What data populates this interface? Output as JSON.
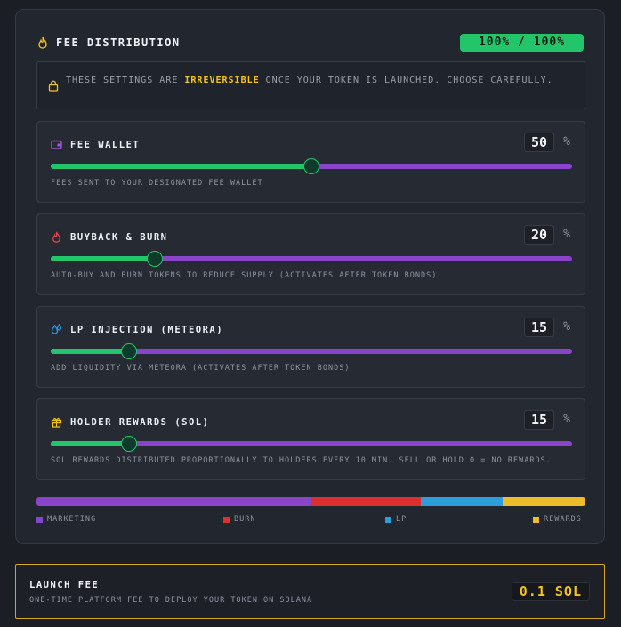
{
  "distribution": {
    "title": "FEE DISTRIBUTION",
    "badge": "100% / 100%",
    "warning": {
      "prefix": "THESE SETTINGS ARE ",
      "highlight": "IRREVERSIBLE",
      "suffix": " ONCE YOUR TOKEN IS LAUNCHED. CHOOSE CAREFULLY."
    },
    "percent_sign": "%",
    "sliders": [
      {
        "title": "FEE WALLET",
        "value": 50,
        "description": "FEES SENT TO YOUR DESIGNATED FEE WALLET",
        "icon": "wallet-icon",
        "icon_color": "#9b59d6"
      },
      {
        "title": "BUYBACK & BURN",
        "value": 20,
        "description": "AUTO-BUY AND BURN TOKENS TO REDUCE SUPPLY (ACTIVATES AFTER TOKEN BONDS)",
        "icon": "flame-icon",
        "icon_color": "#e04444"
      },
      {
        "title": "LP INJECTION (METEORA)",
        "value": 15,
        "description": "ADD LIQUIDITY VIA METEORA (ACTIVATES AFTER TOKEN BONDS)",
        "icon": "droplets-icon",
        "icon_color": "#2e9be0"
      },
      {
        "title": "HOLDER REWARDS (SOL)",
        "value": 15,
        "description": "SOL REWARDS DISTRIBUTED PROPORTIONALLY TO HOLDERS EVERY 10 MIN. SELL OR HOLD 0 = NO REWARDS.",
        "icon": "gift-icon",
        "icon_color": "#f5c518"
      }
    ],
    "legend": [
      {
        "label": "MARKETING",
        "color": "#8a44c9",
        "share": 50
      },
      {
        "label": "BURN",
        "color": "#dc2f2f",
        "share": 20
      },
      {
        "label": "LP",
        "color": "#2b9fdc",
        "share": 15
      },
      {
        "label": "REWARDS",
        "color": "#f0bb2b",
        "share": 15
      }
    ]
  },
  "launch_fee": {
    "title": "LAUNCH FEE",
    "description": "ONE-TIME PLATFORM FEE TO DEPLOY YOUR TOKEN ON SOLANA",
    "amount": "0.1 SOL"
  },
  "colors": {
    "accent_green": "#22c56a",
    "track_purple": "#8a44c9",
    "highlight_yellow": "#f5c518"
  }
}
